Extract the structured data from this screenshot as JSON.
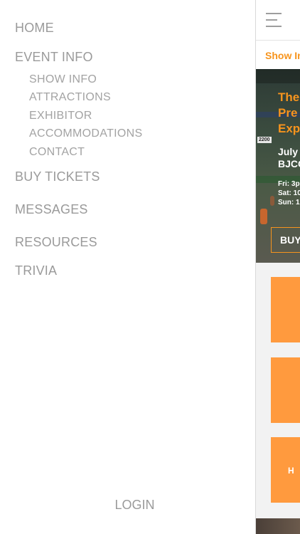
{
  "drawer": {
    "nav": {
      "home": "HOME",
      "event_info": "EVENT INFO",
      "buy_tickets": "BUY TICKETS",
      "messages": "MESSAGES",
      "resources": "RESOURCES",
      "trivia": "TRIVIA"
    },
    "event_info_sub": {
      "show_info": "SHOW INFO",
      "attractions": "ATTRACTIONS",
      "exhibitor": "EXHIBITOR",
      "accommodations": "ACCOMMODATIONS",
      "contact": "CONTACT"
    },
    "login": "LOGIN"
  },
  "main": {
    "tab_label": "Show In",
    "hero": {
      "title_line1": "The",
      "title_line2": "Pre",
      "title_line3": "Exp",
      "date_text": "July",
      "venue_text": "BJCC",
      "hours_fri": "Fri: 3p",
      "hours_sat": "Sat: 10",
      "hours_sun": "Sun: 1",
      "sign_text": "2200",
      "buy_label": "BUY"
    },
    "tile_text": "H U"
  },
  "colors": {
    "accent": "#f7941d",
    "tile": "#ff9a3e",
    "nav_text": "#9a9a9a"
  }
}
